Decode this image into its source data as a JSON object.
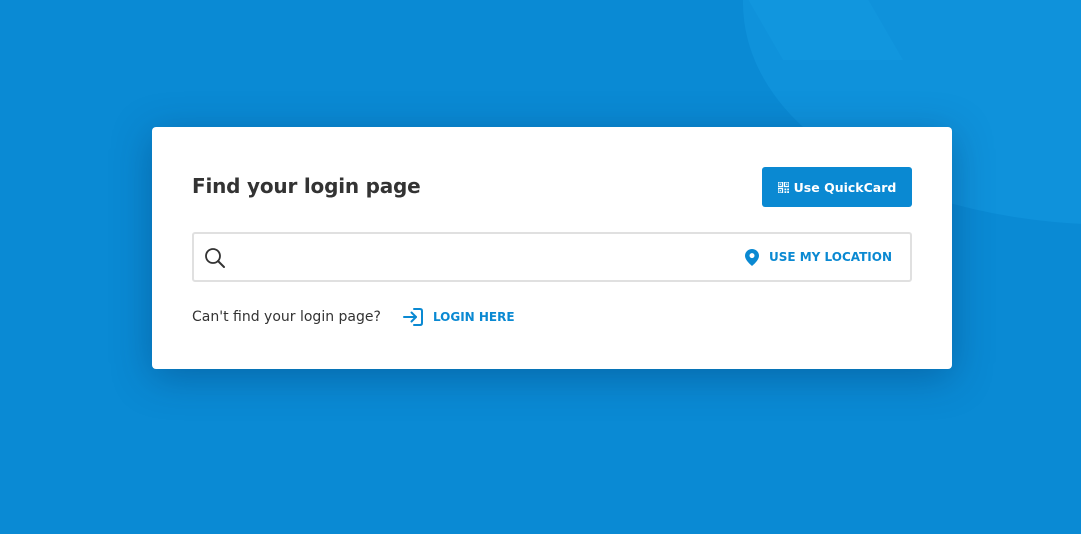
{
  "colors": {
    "background": "#0a8ad4",
    "accent": "#0a89d2",
    "title_text": "#333333",
    "card": "#ffffff"
  },
  "card": {
    "title": "Find your login page",
    "quickcard_button": {
      "label": "Use QuickCard",
      "icon": "qr-code-icon"
    },
    "search": {
      "value": "",
      "placeholder": "",
      "icon": "search-icon",
      "location_button": {
        "label": "USE MY LOCATION",
        "icon": "location-pin-icon"
      }
    },
    "help": {
      "text": "Can't find your login page?",
      "login_link": {
        "label": "LOGIN HERE",
        "icon": "login-arrow-icon"
      }
    }
  }
}
